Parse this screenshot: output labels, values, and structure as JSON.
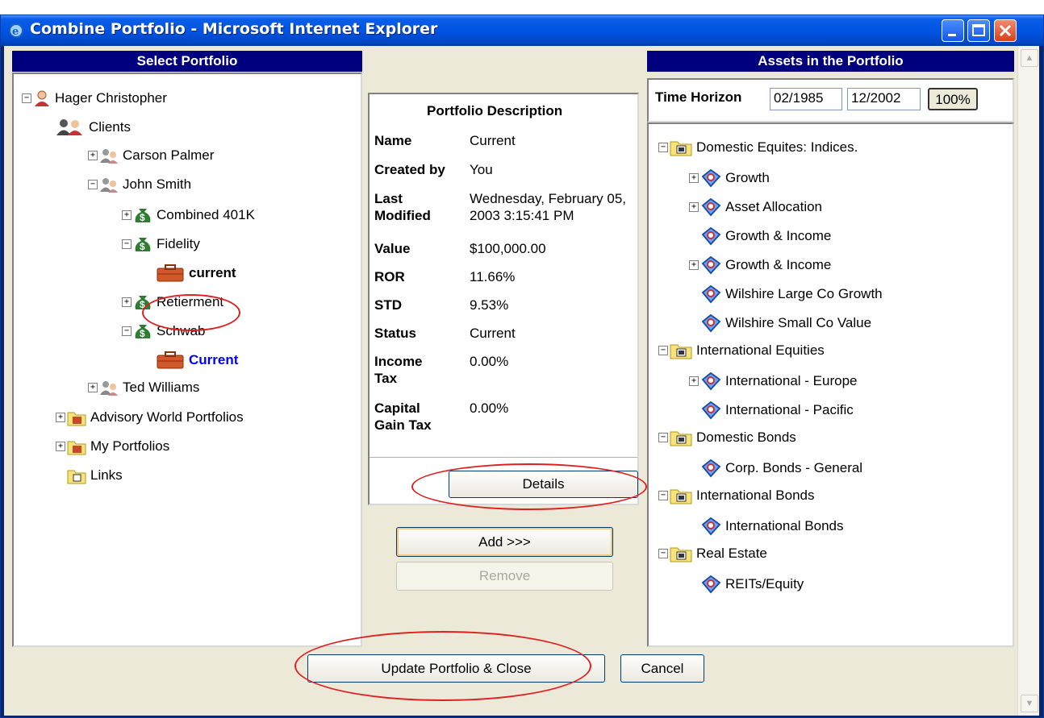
{
  "window": {
    "title": "Combine Portfolio - Microsoft Internet Explorer"
  },
  "left_panel": {
    "header": "Select Portfolio",
    "tree": [
      {
        "label": "Hager Christopher"
      },
      {
        "label": "Clients"
      },
      {
        "label": "Carson Palmer"
      },
      {
        "label": "John Smith"
      },
      {
        "label": "Combined 401K"
      },
      {
        "label": "Fidelity"
      },
      {
        "label": "current"
      },
      {
        "label": "Retierment"
      },
      {
        "label": "Schwab"
      },
      {
        "label": "Current"
      },
      {
        "label": "Ted Williams"
      },
      {
        "label": "Advisory World Portfolios"
      },
      {
        "label": "My Portfolios"
      },
      {
        "label": "Links"
      }
    ]
  },
  "description": {
    "title": "Portfolio Description",
    "rows": [
      {
        "label": "Name",
        "value": "Current"
      },
      {
        "label": "Created by",
        "value": "You"
      },
      {
        "label": "Last Modified",
        "value": "Wednesday, February 05, 2003 3:15:41 PM"
      },
      {
        "label": "Value",
        "value": "$100,000.00"
      },
      {
        "label": "ROR",
        "value": "11.66%"
      },
      {
        "label": "STD",
        "value": "9.53%"
      },
      {
        "label": "Status",
        "value": "Current"
      },
      {
        "label": "Income Tax",
        "value": "0.00%"
      },
      {
        "label": "Capital Gain Tax",
        "value": "0.00%"
      }
    ],
    "details_button": "Details"
  },
  "actions": {
    "add": "Add >>>",
    "remove": "Remove"
  },
  "right_panel": {
    "header": "Assets in the Portfolio",
    "time_horizon_label": "Time Horizon",
    "start": "02/1985",
    "end": "12/2002",
    "pct": "100%",
    "tree": [
      {
        "label": "Domestic Equites: Indices."
      },
      {
        "label": "Growth"
      },
      {
        "label": "Asset Allocation"
      },
      {
        "label": "Growth & Income"
      },
      {
        "label": "Growth & Income"
      },
      {
        "label": "Wilshire Large Co Growth"
      },
      {
        "label": "Wilshire Small Co Value"
      },
      {
        "label": "International Equities"
      },
      {
        "label": "International - Europe"
      },
      {
        "label": "International - Pacific"
      },
      {
        "label": "Domestic Bonds"
      },
      {
        "label": "Corp. Bonds - General"
      },
      {
        "label": "International Bonds"
      },
      {
        "label": "International Bonds"
      },
      {
        "label": "Real Estate"
      },
      {
        "label": "REITs/Equity"
      }
    ]
  },
  "footer": {
    "update": "Update Portfolio & Close",
    "cancel": "Cancel"
  },
  "colors": {
    "panel_header": "#00007f",
    "annotation": "#e02020",
    "titlebar": "#0054e3"
  }
}
